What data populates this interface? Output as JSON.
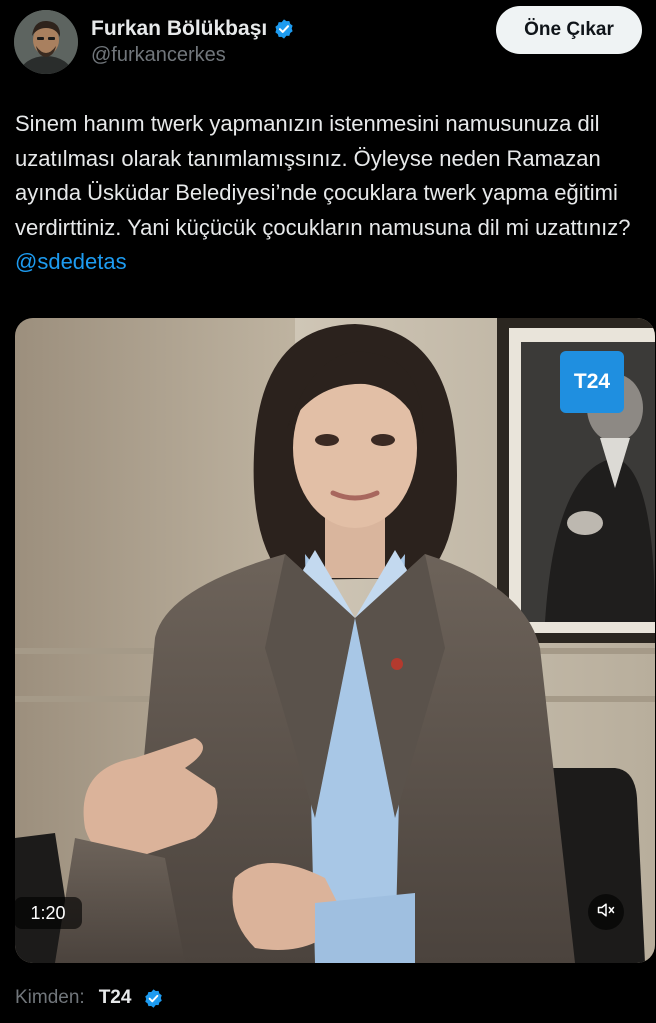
{
  "author": {
    "display_name": "Furkan Bölükbaşı",
    "username": "@furkancerkes",
    "verified": true
  },
  "header": {
    "highlight_button": "Öne Çıkar"
  },
  "tweet": {
    "text": "Sinem hanım twerk yapmanızın istenmesini namusunuza dil uzatılması olarak tanımlamışsınız. Öyleyse neden Ramazan ayında Üsküdar Belediyesi’nde çocuklara twerk yapma eğitimi verdirttiniz. Yani küçücük çocukların namusuna dil mi uzattınız?",
    "mention": "@sdedetas"
  },
  "video": {
    "logo_text": "T24",
    "duration": "1:20",
    "mute_icon": "speaker-muted-icon"
  },
  "source": {
    "label": "Kimden:",
    "name": "T24",
    "verified": true
  },
  "colors": {
    "background": "#000000",
    "primary_text": "#e7e9ea",
    "secondary_text": "#71767b",
    "link": "#1d9bf0",
    "verified_badge": "#1d9bf0",
    "button_bg": "#eff3f4",
    "logo_bg": "#1f8fe0"
  }
}
